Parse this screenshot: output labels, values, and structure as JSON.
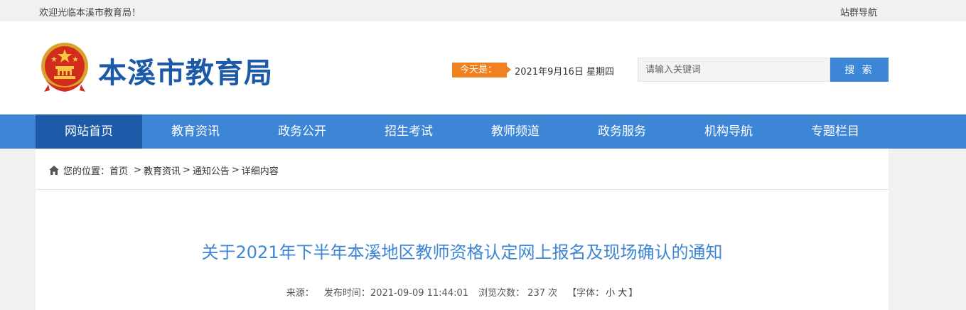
{
  "topbar": {
    "welcome": "欢迎光临本溪市教育局！",
    "sitemap": "站群导航"
  },
  "header": {
    "site_title": "本溪市教育局",
    "date_label": "今天是：",
    "date_value": "2021年9月16日 星期四",
    "search_placeholder": "请输入关键词",
    "search_button": "搜 索"
  },
  "nav": {
    "items": [
      {
        "label": "网站首页"
      },
      {
        "label": "教育资讯"
      },
      {
        "label": "政务公开"
      },
      {
        "label": "招生考试"
      },
      {
        "label": "教师频道"
      },
      {
        "label": "政务服务"
      },
      {
        "label": "机构导航"
      },
      {
        "label": "专题栏目"
      }
    ]
  },
  "breadcrumb": {
    "prefix": "您的位置：",
    "items": [
      "首页",
      "教育资讯",
      "通知公告",
      "详细内容"
    ],
    "separator": ">"
  },
  "article": {
    "title": "关于2021年下半年本溪地区教师资格认定网上报名及现场确认的通知",
    "source_label": "来源：",
    "publish_label": "发布时间：",
    "publish_time": "2021-09-09 11:44:01",
    "views_label": "浏览次数：",
    "views_count": "237",
    "views_unit": "次",
    "font_label": "【字体：",
    "font_small": "小",
    "font_large": "大",
    "font_close": "】"
  },
  "colors": {
    "primary_blue": "#3d86d6",
    "dark_blue": "#1c5aa8",
    "accent_orange": "#f1801f"
  }
}
